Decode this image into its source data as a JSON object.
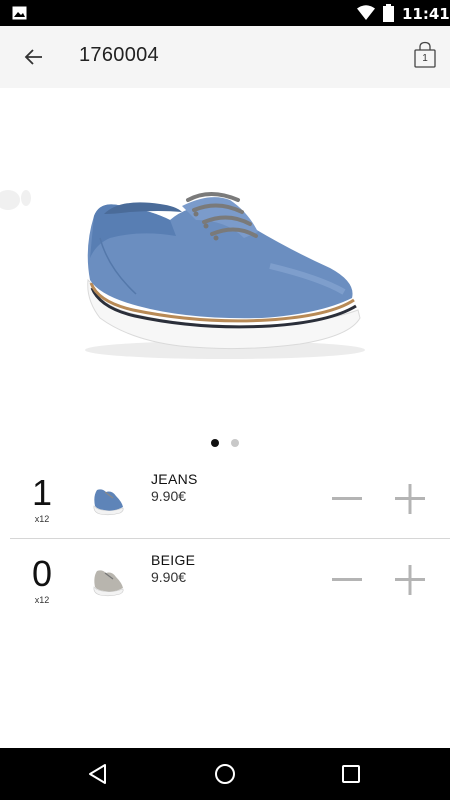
{
  "status_bar": {
    "time": "11:41",
    "icons": [
      "gallery-icon",
      "wifi-icon",
      "battery-icon"
    ]
  },
  "app_bar": {
    "title": "1760004",
    "back_icon": "arrow-left-icon",
    "cart_icon": "shopping-bag-icon",
    "cart_count": "1"
  },
  "carousel": {
    "page_count": 2,
    "active_index": 0
  },
  "variants": [
    {
      "quantity": "1",
      "pack": "x12",
      "color_name": "JEANS",
      "price": "9.90€",
      "swatch": "#5e84b8"
    },
    {
      "quantity": "0",
      "pack": "x12",
      "color_name": "BEIGE",
      "price": "9.90€",
      "swatch": "#b8b5ae"
    }
  ],
  "colors": {
    "app_bar_bg": "#f5f5f5",
    "stepper_icon": "#b4b4b4",
    "system_bars": "#000000"
  },
  "nav_bar": {
    "icons": [
      "back-triangle-icon",
      "home-circle-icon",
      "recents-square-icon"
    ]
  }
}
